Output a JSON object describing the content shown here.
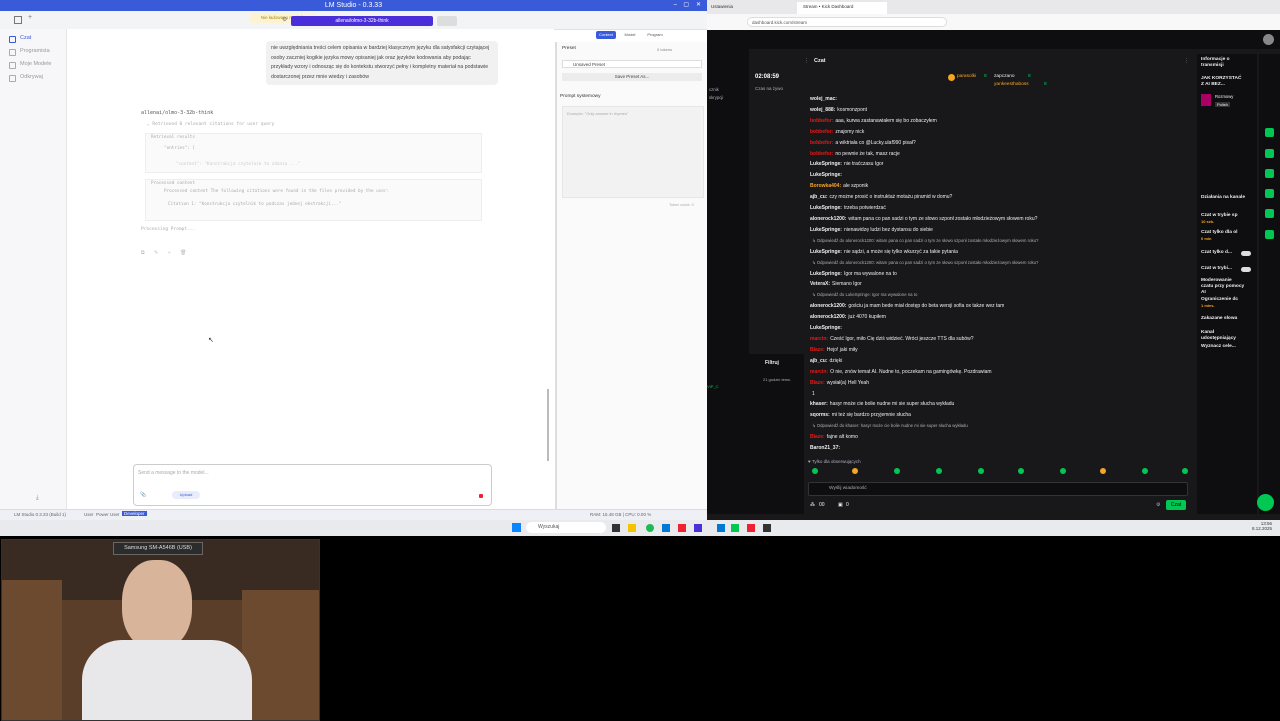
{
  "lm_studio": {
    "window_title": "LM Studio - 0.3.33",
    "tab_label": "Nie ładowano modelu",
    "model_selector": "allenai/olmo-3-32b-think",
    "sidebar": {
      "items": [
        {
          "label": "Czat"
        },
        {
          "label": "Programista"
        },
        {
          "label": "Moje Modele"
        },
        {
          "label": "Odkrywaj"
        }
      ]
    },
    "header_buttons": {
      "context": "Context",
      "model": "Model",
      "program": "Program"
    },
    "user_message": "nie uwzględniania treści celem opisania w bardziej klasycznym języku dla satysfakcji czytającej osoby zaczniej kogikie języka mowy opisaniej jak oraz języków kodowania aby podając przykłady wzory i odnosząc się do kontekstu stworzyć pełny i kompletny materiał na podstawie dostarczonej przez mnie wiedzy i zasobów",
    "assistant_model": "allenai/olmo-3-32b-think",
    "thinking_label": "Retrieved 0 relevant citations for user query",
    "thinking_box1_title": "Retrieval results",
    "thinking_box1_text": "\"entries\": [",
    "thinking_box2_title": "Processed content",
    "thinking_box2_text": "Processed content The following citations were found in the files provided by the user:",
    "thinking_box2_sub": "Citation 1: \"Konstrukcja czytelnik to podczas jednej ekstrakcji...\"",
    "processing_label": "Processing Prompt...",
    "right_panel": {
      "preset_label": "Preset",
      "preset_value": "Unsaved Preset",
      "save_preset": "Save Preset As...",
      "system_prompt_label": "Prompt systemowy",
      "system_prompt_placeholder": "Example: \"Only answer in rhymes\"",
      "token_count": "Token count: 0",
      "tokens_extra": "0 tokens"
    },
    "composer": {
      "placeholder": "Send a message to the model...",
      "upload_label": "Upload"
    },
    "status": {
      "app": "LM Studio 0.3.33 (Build 1)",
      "user_label": "User",
      "power_user": "Power User",
      "developer": "Developer",
      "ram": "RAM: 15.48 GB | CPU: 0.00 %"
    }
  },
  "taskbar": {
    "search_placeholder": "Wyszukaj",
    "time": "13:56",
    "date": "8.12.2025"
  },
  "browser": {
    "tab1": "Ustawienia",
    "tab2": "Stream • Kick Dashboard",
    "address": "dashboard.kick.com/stream"
  },
  "dashboard": {
    "chat_title": "Czat",
    "stream_time": "02:08:59",
    "stream_time_label": "Czas na żywo",
    "left_label1": "cznik",
    "left_label2": "skrypcji",
    "activity_title": "Filtruj",
    "activity_sub": "21 godzin temu",
    "activity_badge": "VIP_C",
    "top_badges": [
      {
        "name": "parasolki",
        "count": "8"
      },
      {
        "name": "zapczano",
        "count": "8"
      },
      {
        "name": "yankeesthaboss",
        "count": "8"
      }
    ],
    "chat_lines": [
      {
        "user": "wolej_mac:",
        "text": "",
        "color": "#efeff1",
        "reply": false
      },
      {
        "user": "wolej_888:",
        "text": "kosmonzpont",
        "color": "#efeff1",
        "reply": false
      },
      {
        "user": "bobbefor:",
        "text": "aaa, kurwa zastanawiałem się bo zobaczyłem",
        "color": "#e91916",
        "reply": false
      },
      {
        "user": "bobbefor:",
        "text": "znajomy nick",
        "color": "#e91916",
        "reply": false
      },
      {
        "user": "bobbefor:",
        "text": "a wiktriała co @Lucky.ulaf990 pisał?",
        "color": "#e91916",
        "reply": false
      },
      {
        "user": "bobbefor:",
        "text": "no pewnie że tak, masz racje",
        "color": "#e91916",
        "reply": false
      },
      {
        "user": "LukeSpringe:",
        "text": "nie traćczasu Igor",
        "color": "#efeff1",
        "reply": false
      },
      {
        "user": "LukeSpringe:",
        "text": "",
        "color": "#efeff1",
        "reply": false
      },
      {
        "user": "Borowka404:",
        "text": "ale szponik",
        "color": "#f5a623",
        "reply": false
      },
      {
        "user": "ajb_cu:",
        "text": "czy możne prosić o instruktaż motażu piramid w domu?",
        "color": "#efeff1",
        "reply": false
      },
      {
        "user": "LukeSpringe:",
        "text": "trzeba potwierdzać",
        "color": "#efeff1",
        "reply": false
      },
      {
        "user": "alonerock1200:",
        "text": "witam pana co pan sadzi o tym ze słowo szponł zostało młodzieżowym słowem roku?",
        "color": "#efeff1",
        "reply": false
      },
      {
        "user": "LukeSpringe:",
        "text": "nienawidzę ludzi bez dystansu do siebie",
        "color": "#efeff1",
        "reply": false
      },
      {
        "user": "",
        "text": "↳ Odpowiedź do alonerock1200: witam pana co pan sadzi o tym ze słowo szponł zostało młodzieżowym słowem roku?",
        "color": "#adadb8",
        "reply": true
      },
      {
        "user": "LukeSpringe:",
        "text": "nie sądzi, a może się tylko wkurzyć za takie pytania",
        "color": "#efeff1",
        "reply": false
      },
      {
        "user": "",
        "text": "↳ Odpowiedź do alonerock1200: witam pana co pan sadzi o tym ze słowo szponł zostało młodzieżowym słowem roku?",
        "color": "#adadb8",
        "reply": true
      },
      {
        "user": "LukeSpringe:",
        "text": "Igor ma wywalone na to",
        "color": "#efeff1",
        "reply": false
      },
      {
        "user": "VeteraX:",
        "text": "Siemano Igor",
        "color": "#efeff1",
        "reply": false
      },
      {
        "user": "",
        "text": "↳ Odpowiedź do LukeSpringe: Igor ma wywalone na to",
        "color": "#adadb8",
        "reply": true
      },
      {
        "user": "alonerock1200:",
        "text": "gościu ja mam bede miał dostęp do beta wersji sofia ox takze wez tam",
        "color": "#efeff1",
        "reply": false
      },
      {
        "user": "alonerock1200:",
        "text": "już 4070 kupiłem",
        "color": "#efeff1",
        "reply": false
      },
      {
        "user": "LukeSpringe:",
        "text": "",
        "color": "#efeff1",
        "reply": false
      },
      {
        "user": "marcin:",
        "text": "Cześć Igor, miło Cię dziś widzieć. Wróci jeszcze TTS dla subów?",
        "color": "#e91916",
        "reply": false
      },
      {
        "user": "Blaze:",
        "text": "Hejo! jaki miły",
        "color": "#e91916",
        "reply": false
      },
      {
        "user": "ajb_cu:",
        "text": "dzięki",
        "color": "#efeff1",
        "reply": false
      },
      {
        "user": "marcin:",
        "text": "O nie, znów temat AI. Nudne to, poczekam na gamingówkę. Pozdrawiam",
        "color": "#e91916",
        "reply": false
      },
      {
        "user": "Blaze:",
        "text": "wysłał(a) Hell Yeah",
        "color": "#e91916",
        "reply": false
      },
      {
        "user": "",
        "text": "1",
        "color": "#efeff1",
        "reply": false
      },
      {
        "user": "khaser:",
        "text": "hasyr może cie bolie nudne mi sie super słucha wykładu",
        "color": "#efeff1",
        "reply": false
      },
      {
        "user": "sqorms:",
        "text": "mi też się bardzo przyjemnie słucha",
        "color": "#efeff1",
        "reply": false
      },
      {
        "user": "",
        "text": "↳ Odpowiedź do khaser: hasyr może cie bolie nudne mi sie super słucha wykładu",
        "color": "#adadb8",
        "reply": true
      },
      {
        "user": "Blaze:",
        "text": "fajne alt komo",
        "color": "#e91916",
        "reply": false
      },
      {
        "user": "Baron21_37:",
        "text": "",
        "color": "#efeff1",
        "reply": false
      }
    ],
    "followers_only": "♥ Tylko dla obserwujących",
    "chat_input_placeholder": "Wyślij wiadomość",
    "viewers": "00",
    "points": "0",
    "send_button": "Czat",
    "info_title": "Informacje o transmisji",
    "stream_title": "JAK KORZYSTAĆ Z AI BEZ...",
    "category": "Rozmowy",
    "language": "Polish",
    "actions_title": "Działania na kanale",
    "actions": [
      {
        "label": "Czat w trybie sp",
        "sub": "10 sek."
      },
      {
        "label": "Czat tylko dla ol",
        "sub": "0 min"
      },
      {
        "label": "Czat tylko d...",
        "sub": ""
      },
      {
        "label": "Czat w trybi...",
        "sub": ""
      },
      {
        "label": "Moderowanie czatu przy pomocy AI",
        "sub": ""
      },
      {
        "label": "Ograniczenie dc",
        "sub": "1 mies."
      },
      {
        "label": "Zakazane słowa",
        "sub": ""
      },
      {
        "label": "Kanał udostępniający",
        "sub": ""
      },
      {
        "label": "Wyznacz cele...",
        "sub": ""
      }
    ]
  },
  "webcam": {
    "label": "Samsung SM-A546B (USB)"
  },
  "colors": {
    "lm_accent": "#3a5bd9",
    "kick_green": "#00c853",
    "kick_bg": "#18181b"
  }
}
